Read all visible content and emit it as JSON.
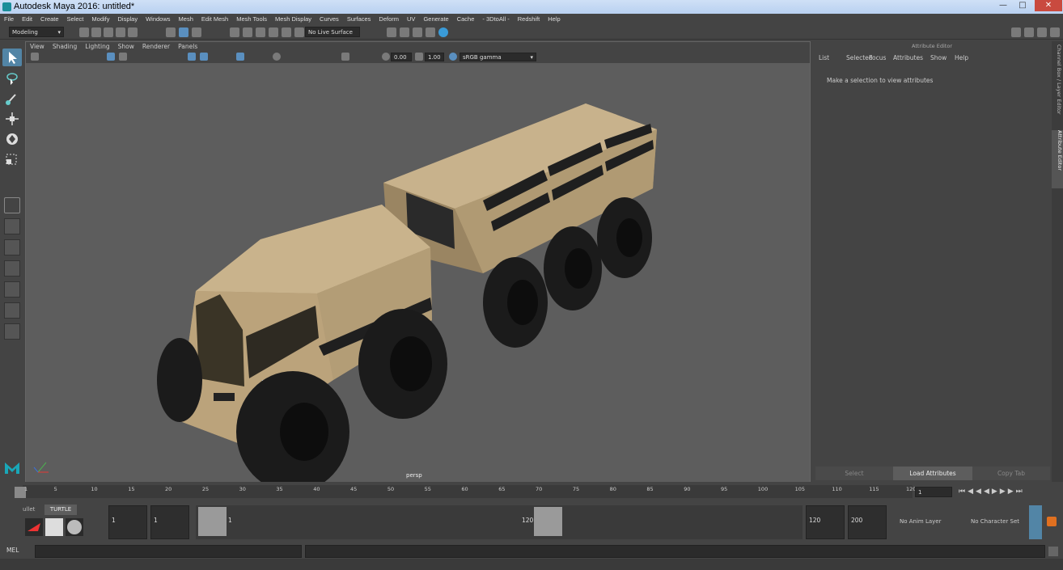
{
  "window": {
    "title": "Autodesk Maya 2016: untitled*"
  },
  "menubar": [
    "File",
    "Edit",
    "Create",
    "Select",
    "Modify",
    "Display",
    "Windows",
    "Mesh",
    "Edit Mesh",
    "Mesh Tools",
    "Mesh Display",
    "Curves",
    "Surfaces",
    "Deform",
    "UV",
    "Generate",
    "Cache",
    "- 3DtoAll -",
    "Redshift",
    "Help"
  ],
  "statusline": {
    "mode": "Modeling",
    "live_surface": "No Live Surface"
  },
  "viewport": {
    "menu": [
      "View",
      "Shading",
      "Lighting",
      "Show",
      "Renderer",
      "Panels"
    ],
    "near_clip": "0.00",
    "exposure": "1.00",
    "color_space": "sRGB gamma",
    "camera_label": "persp"
  },
  "attribute_editor": {
    "title": "Attribute Editor",
    "tabs": [
      "List",
      "Selected",
      "Focus",
      "Attributes",
      "Show",
      "Help"
    ],
    "message": "Make a selection to view attributes",
    "buttons": {
      "select": "Select",
      "load": "Load Attributes",
      "copy": "Copy Tab"
    }
  },
  "sidebar": {
    "channel_box": "Channel Box / Layer Editor",
    "attribute_editor": "Attribute Editor"
  },
  "timeline": {
    "ticks": [
      "1",
      "5",
      "10",
      "15",
      "20",
      "25",
      "30",
      "35",
      "40",
      "45",
      "50",
      "55",
      "60",
      "65",
      "70",
      "75",
      "80",
      "85",
      "90",
      "95",
      "100",
      "105",
      "110",
      "115",
      "120"
    ],
    "current_frame": "1"
  },
  "range": {
    "shelf_tab_left": "ullet",
    "shelf_tab": "TURTLE",
    "start": "1",
    "playback_start": "1",
    "slider_start": "1",
    "slider_end": "120",
    "playback_end": "120",
    "end": "200",
    "anim_layer": "No Anim Layer",
    "character_set": "No Character Set"
  },
  "cmdline": {
    "label": "MEL"
  }
}
